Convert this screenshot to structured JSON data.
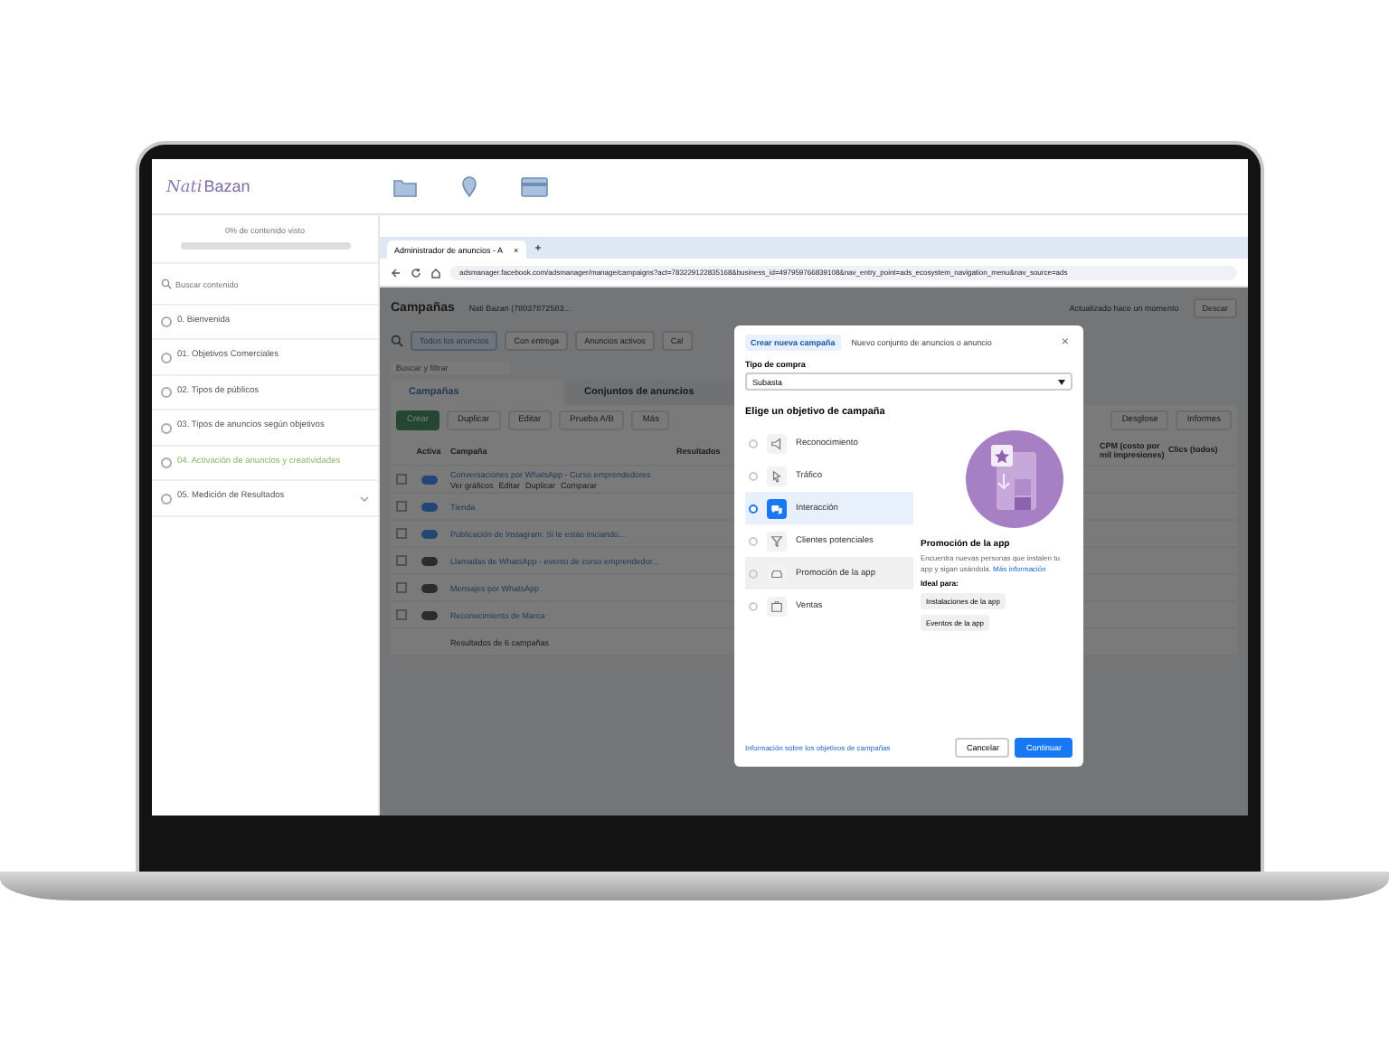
{
  "site_header": {
    "logo_script": "Nati",
    "logo_text": "Bazan"
  },
  "sidebar": {
    "progress_label": "0% de contenido visto",
    "progress": {
      "level": 0
    },
    "search": {
      "placeholder": "Buscar contenido"
    },
    "items": [
      {
        "label": "0. Bienvenida",
        "selected": false,
        "expandable": false
      },
      {
        "label": "01. Objetivos Comerciales",
        "selected": false,
        "expandable": false
      },
      {
        "label": "02. Tipos de públicos",
        "selected": false,
        "expandable": false
      },
      {
        "label": "03. Tipos de anuncios según objetivos",
        "selected": false,
        "expandable": false
      },
      {
        "label": "04. Activación de anuncios y creatividades",
        "selected": true,
        "expandable": false
      },
      {
        "label": "05. Medición de Resultados",
        "selected": false,
        "expandable": true
      }
    ]
  },
  "browser": {
    "tab_title": "Administrador de anuncios - A",
    "tab_close": "×",
    "new_tab": "+",
    "url": "adsmanager.facebook.com/adsmanager/manage/campaigns?act=783229122835168&business_id=497959766839108&nav_entry_point=ads_ecosystem_navigation_menu&nav_source=ads"
  },
  "ads_manager": {
    "title": "Campañas",
    "account": "Nati Bazan (78037872583...",
    "updated": "Actualizado hace un momento",
    "discard": "Descar",
    "filters": [
      {
        "label": "Todos los anuncios",
        "selected": true
      },
      {
        "label": "Con entrega",
        "selected": false
      },
      {
        "label": "Anuncios activos",
        "selected": false
      },
      {
        "label": "Cal",
        "selected": false
      }
    ],
    "search_placeholder": "Buscar y filtrar",
    "tabs": [
      {
        "label": "Campañas",
        "selected": true
      },
      {
        "label": "Conjuntos de anuncios",
        "selected": false
      }
    ],
    "toolbar": [
      "Crear",
      "Duplicar",
      "Editar",
      "Prueba A/B",
      "Más"
    ],
    "toolbar_right": [
      "Desglose",
      "Informes"
    ],
    "columns": [
      "Activa",
      "Campaña",
      "Resultados",
      "CPM (costo por mil impresiones)",
      "Clics (todos)"
    ],
    "rows": [
      {
        "checked": false,
        "active": true,
        "name": "Conversaciones por WhatsApp - Curso emprendedores",
        "actions": [
          "Ver gráficos",
          "Editar",
          "Duplicar",
          "Comparar"
        ]
      },
      {
        "checked": false,
        "active": true,
        "name": "Tienda",
        "actions": []
      },
      {
        "checked": false,
        "active": true,
        "name": "Publicación de Instagram: Si te estás iniciando...",
        "actions": []
      },
      {
        "checked": false,
        "active": false,
        "name": "Llamadas de WhatsApp - evento de curso emprendedor...",
        "actions": []
      },
      {
        "checked": false,
        "active": false,
        "name": "Mensajes por WhatsApp",
        "actions": []
      },
      {
        "checked": false,
        "active": false,
        "name": "Reconocimiento de Marca",
        "actions": []
      }
    ],
    "footer": "Resultados de 6 campañas"
  },
  "modal": {
    "tabs": [
      {
        "label": "Crear nueva campaña",
        "selected": true
      },
      {
        "label": "Nuevo conjunto de anuncios o anuncio",
        "selected": false
      }
    ],
    "close": "×",
    "purchase_label": "Tipo de compra",
    "purchase_value": "Subasta",
    "objective_heading": "Elige un objetivo de campaña",
    "objectives": [
      {
        "label": "Reconocimiento",
        "selected": false,
        "hovered": false
      },
      {
        "label": "Tráfico",
        "selected": false,
        "hovered": false
      },
      {
        "label": "Interacción",
        "selected": true,
        "hovered": false
      },
      {
        "label": "Clientes potenciales",
        "selected": false,
        "hovered": false
      },
      {
        "label": "Promoción de la app",
        "selected": false,
        "hovered": true
      },
      {
        "label": "Ventas",
        "selected": false,
        "hovered": false
      }
    ],
    "detail": {
      "title": "Promoción de la app",
      "description": "Encuentra nuevas personas que instalen tu app y sigan usándola.",
      "link": "Más información",
      "ideal_label": "Ideal para:",
      "chips": [
        "Instalaciones de la app",
        "Eventos de la app"
      ]
    },
    "info_link": "Información sobre los objetivos de campañas",
    "cancel": "Cancelar",
    "continue": "Continuar"
  }
}
